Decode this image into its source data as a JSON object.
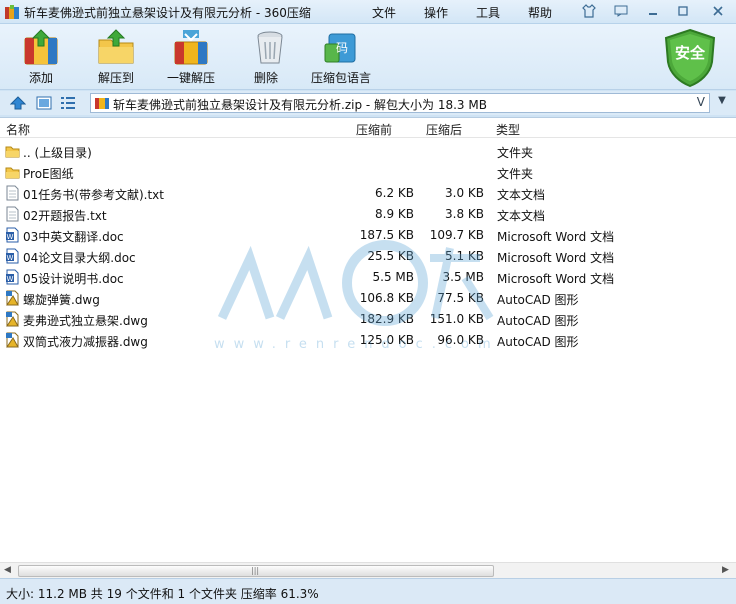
{
  "window": {
    "title": "斩车麦佛逊式前独立悬架设计及有限元分析 - 360压缩",
    "menu": [
      "文件",
      "操作",
      "工具",
      "帮助"
    ]
  },
  "toolbar": {
    "add": "添加",
    "extract_to": "解压到",
    "one_click_extract": "一键解压",
    "delete": "删除",
    "comment_lang": "压缩包语言",
    "security": "安全"
  },
  "address": {
    "text": "斩车麦佛逊式前独立悬架设计及有限元分析.zip - 解包大小为 18.3 MB"
  },
  "columns": {
    "name": "名称",
    "compressed": "压缩前",
    "after": "压缩后",
    "type": "类型"
  },
  "files": [
    {
      "name": ".. (上级目录)",
      "before": "",
      "after": "",
      "type": "文件夹",
      "icon": "folder-icon"
    },
    {
      "name": "ProE图纸",
      "before": "",
      "after": "",
      "type": "文件夹",
      "icon": "folder-icon"
    },
    {
      "name": "01任务书(带参考文献).txt",
      "before": "6.2 KB",
      "after": "3.0 KB",
      "type": "文本文档",
      "icon": "text-file-icon"
    },
    {
      "name": "02开题报告.txt",
      "before": "8.9 KB",
      "after": "3.8 KB",
      "type": "文本文档",
      "icon": "text-file-icon"
    },
    {
      "name": "03中英文翻译.doc",
      "before": "187.5 KB",
      "after": "109.7 KB",
      "type": "Microsoft Word 文档",
      "icon": "word-doc-icon"
    },
    {
      "name": "04论文目录大纲.doc",
      "before": "25.5 KB",
      "after": "5.1 KB",
      "type": "Microsoft Word 文档",
      "icon": "word-doc-icon"
    },
    {
      "name": "05设计说明书.doc",
      "before": "5.5 MB",
      "after": "3.5 MB",
      "type": "Microsoft Word 文档",
      "icon": "word-doc-icon"
    },
    {
      "name": "螺旋弹簧.dwg",
      "before": "106.8 KB",
      "after": "77.5 KB",
      "type": "AutoCAD 图形",
      "icon": "dwg-file-icon"
    },
    {
      "name": "麦弗逊式独立悬架.dwg",
      "before": "182.9 KB",
      "after": "151.0 KB",
      "type": "AutoCAD 图形",
      "icon": "dwg-file-icon"
    },
    {
      "name": "双筒式液力减振器.dwg",
      "before": "125.0 KB",
      "after": "96.0 KB",
      "type": "AutoCAD 图形",
      "icon": "dwg-file-icon"
    }
  ],
  "status": {
    "text": "大小: 11.2 MB 共 19 个文件和 1 个文件夹 压缩率 61.3%"
  }
}
